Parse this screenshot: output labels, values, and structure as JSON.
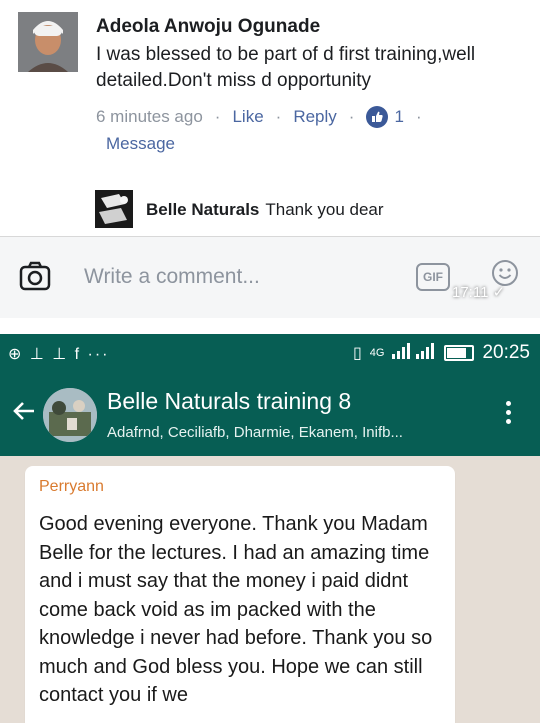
{
  "facebook": {
    "comment": {
      "author": "Adeola Anwoju Ogunade",
      "text": "I was blessed to be part of d first training,well detailed.Don't miss d opportunity",
      "time": "6 minutes ago",
      "like_label": "Like",
      "reply_label": "Reply",
      "like_count": "1",
      "message_label": "Message",
      "separator": "·"
    },
    "reply": {
      "author": "Belle Naturals",
      "text": "Thank you dear"
    },
    "comment_input": {
      "placeholder": "Write a comment...",
      "gif_label": "GIF",
      "timestamp": "17:11"
    },
    "colors": {
      "link": "#4b67a1",
      "like_badge": "#3b5998"
    }
  },
  "whatsapp": {
    "status_bar": {
      "left_icons_text": "⊕ ⊥ ⊥ f ···",
      "network_text": "4G",
      "clock": "20:25"
    },
    "header": {
      "group_name": "Belle Naturals training 8",
      "members": "Adafrnd, Ceciliafb, Dharmie, Ekanem, Inifb..."
    },
    "message": {
      "sender": "Perryann",
      "text": "Good evening everyone. Thank you Madam Belle for the lectures. I had an amazing time and i must say that the money i paid didnt come back void  as im packed with the knowledge i never had before. Thank you so much and God bless you. Hope we can still contact you if we"
    },
    "colors": {
      "header": "#075e54",
      "chat_bg": "#e5ddd5",
      "sender": "#d97b30"
    }
  }
}
